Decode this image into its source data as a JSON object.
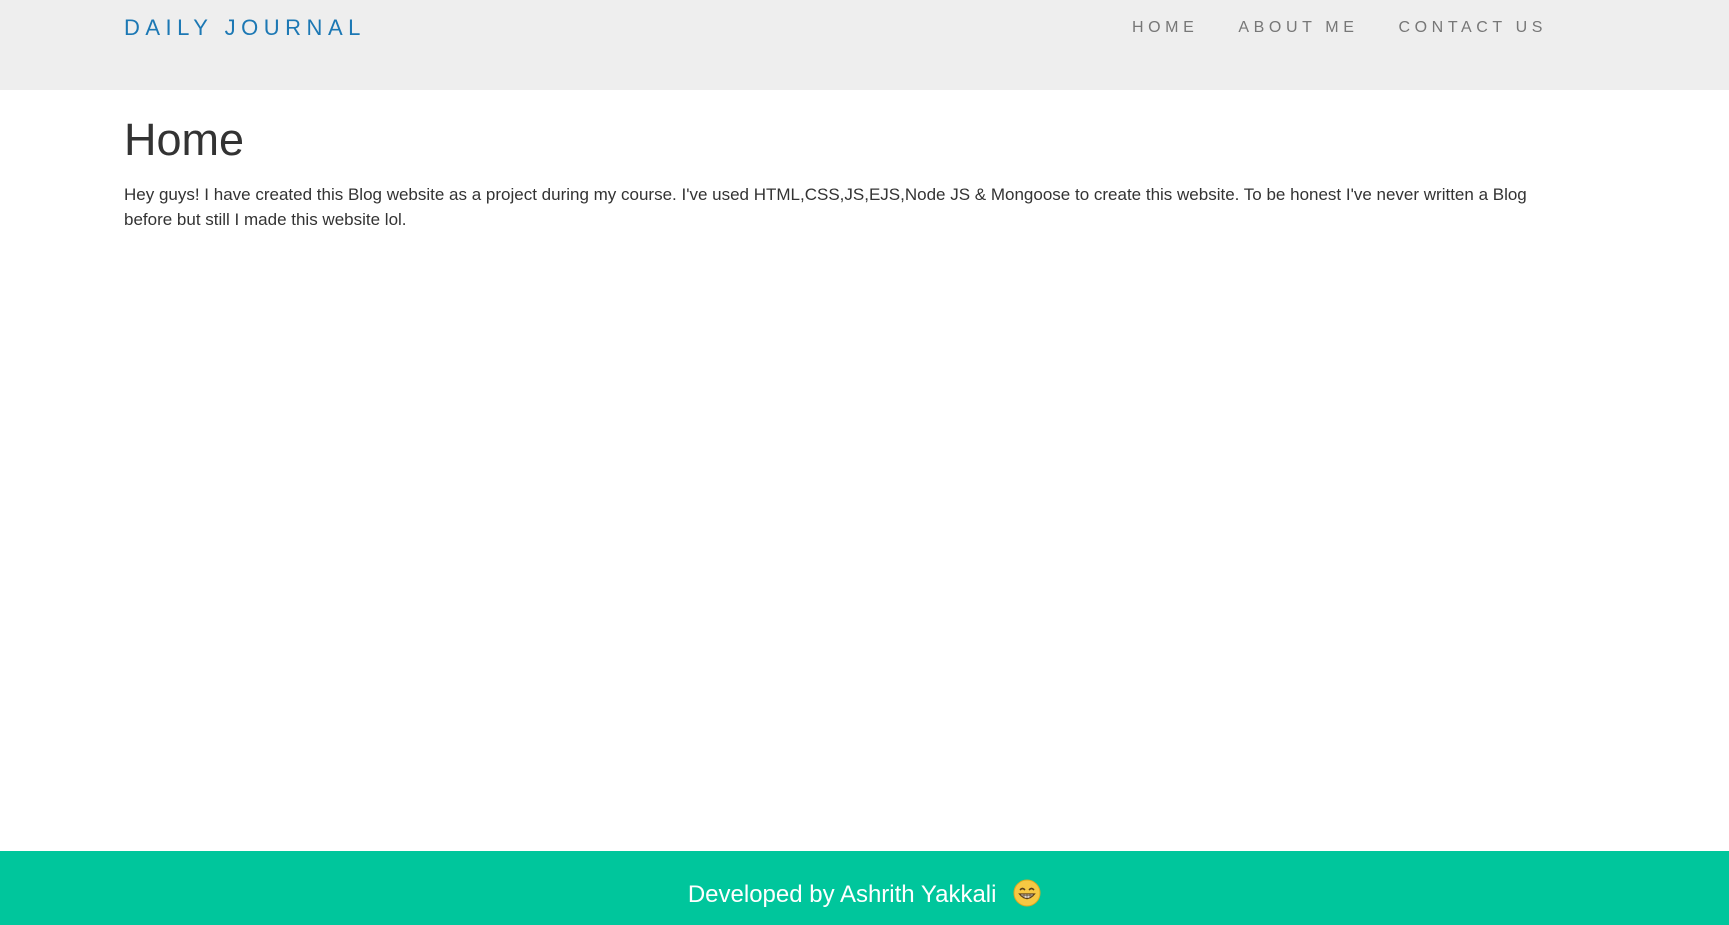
{
  "header": {
    "brand": "DAILY JOURNAL",
    "nav": [
      {
        "label": "HOME"
      },
      {
        "label": "ABOUT ME"
      },
      {
        "label": "CONTACT US"
      }
    ]
  },
  "main": {
    "title": "Home",
    "body": "Hey guys! I have created this Blog website as a project during my course. I've used HTML,CSS,JS,EJS,Node JS & Mongoose to create this website. To be honest I've never written a Blog before but still I made this website lol."
  },
  "footer": {
    "text": "Developed by Ashrith Yakkali",
    "emoji_icon": "grinning-face-icon"
  },
  "colors": {
    "navbar_bg": "#eeeeee",
    "brand": "#1c78b4",
    "nav_link": "#777777",
    "text": "#333333",
    "footer_bg": "#00c69c",
    "footer_text": "#ffffff"
  }
}
